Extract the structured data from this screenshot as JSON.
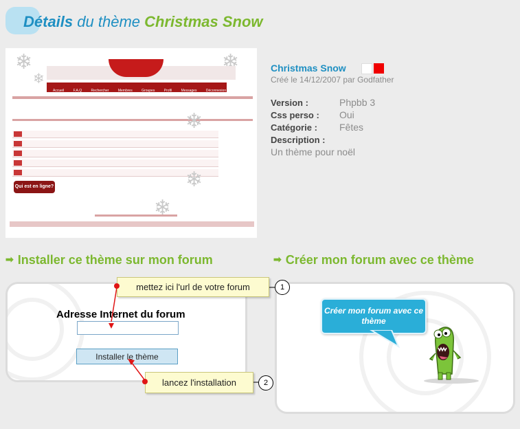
{
  "header": {
    "title_part1": "Détails",
    "title_part2": "du thème",
    "title_part3": "Christmas Snow"
  },
  "preview": {
    "nav_items": [
      "Accueil",
      "F.A.Q",
      "Rechercher",
      "Membres",
      "Groupes",
      "Profil",
      "Messages",
      "Déconnexion"
    ],
    "online_badge": "Qui est en ligne?"
  },
  "theme": {
    "name": "Christmas Snow",
    "created": "Créé le 14/12/2007 par Godfather",
    "swatches": [
      "#ffffff",
      "#f00000"
    ],
    "version_label": "Version :",
    "version_value": "Phpbb 3",
    "css_label": "Css perso :",
    "css_value": "Oui",
    "category_label": "Catégorie :",
    "category_value": "Fêtes",
    "description_label": "Description :",
    "description_value": "Un thème pour noël"
  },
  "sections": {
    "install_heading": "Installer ce thème sur mon forum",
    "create_heading": "Créer mon forum avec ce thème"
  },
  "install_form": {
    "address_label": "Adresse Internet du forum",
    "url_value": "",
    "button_label": "Installer le thème"
  },
  "tips": {
    "tip1": "mettez ici l'url de votre forum",
    "tip1_number": "1",
    "tip2": "lancez l'installation",
    "tip2_number": "2"
  },
  "create": {
    "bubble_text": "Créer mon forum avec ce thème"
  },
  "colors": {
    "accent_blue": "#1e8fc2",
    "accent_green": "#7cb82f",
    "bubble_blue": "#2aaed8"
  }
}
